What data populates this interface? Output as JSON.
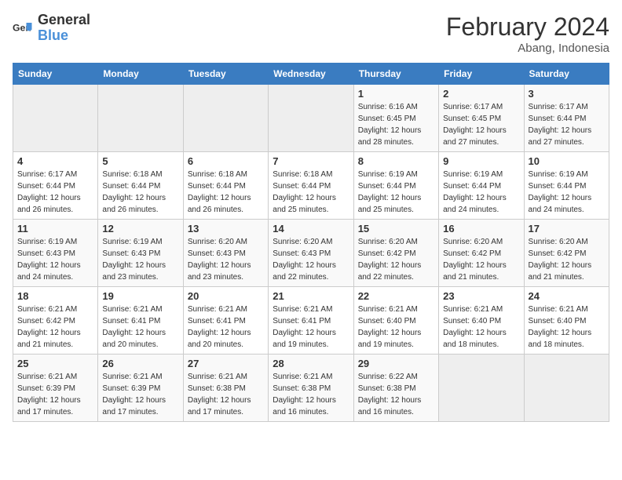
{
  "logo": {
    "text_general": "General",
    "text_blue": "Blue"
  },
  "header": {
    "month_year": "February 2024",
    "location": "Abang, Indonesia"
  },
  "weekdays": [
    "Sunday",
    "Monday",
    "Tuesday",
    "Wednesday",
    "Thursday",
    "Friday",
    "Saturday"
  ],
  "weeks": [
    [
      {
        "day": "",
        "info": ""
      },
      {
        "day": "",
        "info": ""
      },
      {
        "day": "",
        "info": ""
      },
      {
        "day": "",
        "info": ""
      },
      {
        "day": "1",
        "info": "Sunrise: 6:16 AM\nSunset: 6:45 PM\nDaylight: 12 hours\nand 28 minutes."
      },
      {
        "day": "2",
        "info": "Sunrise: 6:17 AM\nSunset: 6:45 PM\nDaylight: 12 hours\nand 27 minutes."
      },
      {
        "day": "3",
        "info": "Sunrise: 6:17 AM\nSunset: 6:44 PM\nDaylight: 12 hours\nand 27 minutes."
      }
    ],
    [
      {
        "day": "4",
        "info": "Sunrise: 6:17 AM\nSunset: 6:44 PM\nDaylight: 12 hours\nand 26 minutes."
      },
      {
        "day": "5",
        "info": "Sunrise: 6:18 AM\nSunset: 6:44 PM\nDaylight: 12 hours\nand 26 minutes."
      },
      {
        "day": "6",
        "info": "Sunrise: 6:18 AM\nSunset: 6:44 PM\nDaylight: 12 hours\nand 26 minutes."
      },
      {
        "day": "7",
        "info": "Sunrise: 6:18 AM\nSunset: 6:44 PM\nDaylight: 12 hours\nand 25 minutes."
      },
      {
        "day": "8",
        "info": "Sunrise: 6:19 AM\nSunset: 6:44 PM\nDaylight: 12 hours\nand 25 minutes."
      },
      {
        "day": "9",
        "info": "Sunrise: 6:19 AM\nSunset: 6:44 PM\nDaylight: 12 hours\nand 24 minutes."
      },
      {
        "day": "10",
        "info": "Sunrise: 6:19 AM\nSunset: 6:44 PM\nDaylight: 12 hours\nand 24 minutes."
      }
    ],
    [
      {
        "day": "11",
        "info": "Sunrise: 6:19 AM\nSunset: 6:43 PM\nDaylight: 12 hours\nand 24 minutes."
      },
      {
        "day": "12",
        "info": "Sunrise: 6:19 AM\nSunset: 6:43 PM\nDaylight: 12 hours\nand 23 minutes."
      },
      {
        "day": "13",
        "info": "Sunrise: 6:20 AM\nSunset: 6:43 PM\nDaylight: 12 hours\nand 23 minutes."
      },
      {
        "day": "14",
        "info": "Sunrise: 6:20 AM\nSunset: 6:43 PM\nDaylight: 12 hours\nand 22 minutes."
      },
      {
        "day": "15",
        "info": "Sunrise: 6:20 AM\nSunset: 6:42 PM\nDaylight: 12 hours\nand 22 minutes."
      },
      {
        "day": "16",
        "info": "Sunrise: 6:20 AM\nSunset: 6:42 PM\nDaylight: 12 hours\nand 21 minutes."
      },
      {
        "day": "17",
        "info": "Sunrise: 6:20 AM\nSunset: 6:42 PM\nDaylight: 12 hours\nand 21 minutes."
      }
    ],
    [
      {
        "day": "18",
        "info": "Sunrise: 6:21 AM\nSunset: 6:42 PM\nDaylight: 12 hours\nand 21 minutes."
      },
      {
        "day": "19",
        "info": "Sunrise: 6:21 AM\nSunset: 6:41 PM\nDaylight: 12 hours\nand 20 minutes."
      },
      {
        "day": "20",
        "info": "Sunrise: 6:21 AM\nSunset: 6:41 PM\nDaylight: 12 hours\nand 20 minutes."
      },
      {
        "day": "21",
        "info": "Sunrise: 6:21 AM\nSunset: 6:41 PM\nDaylight: 12 hours\nand 19 minutes."
      },
      {
        "day": "22",
        "info": "Sunrise: 6:21 AM\nSunset: 6:40 PM\nDaylight: 12 hours\nand 19 minutes."
      },
      {
        "day": "23",
        "info": "Sunrise: 6:21 AM\nSunset: 6:40 PM\nDaylight: 12 hours\nand 18 minutes."
      },
      {
        "day": "24",
        "info": "Sunrise: 6:21 AM\nSunset: 6:40 PM\nDaylight: 12 hours\nand 18 minutes."
      }
    ],
    [
      {
        "day": "25",
        "info": "Sunrise: 6:21 AM\nSunset: 6:39 PM\nDaylight: 12 hours\nand 17 minutes."
      },
      {
        "day": "26",
        "info": "Sunrise: 6:21 AM\nSunset: 6:39 PM\nDaylight: 12 hours\nand 17 minutes."
      },
      {
        "day": "27",
        "info": "Sunrise: 6:21 AM\nSunset: 6:38 PM\nDaylight: 12 hours\nand 17 minutes."
      },
      {
        "day": "28",
        "info": "Sunrise: 6:21 AM\nSunset: 6:38 PM\nDaylight: 12 hours\nand 16 minutes."
      },
      {
        "day": "29",
        "info": "Sunrise: 6:22 AM\nSunset: 6:38 PM\nDaylight: 12 hours\nand 16 minutes."
      },
      {
        "day": "",
        "info": ""
      },
      {
        "day": "",
        "info": ""
      }
    ]
  ]
}
